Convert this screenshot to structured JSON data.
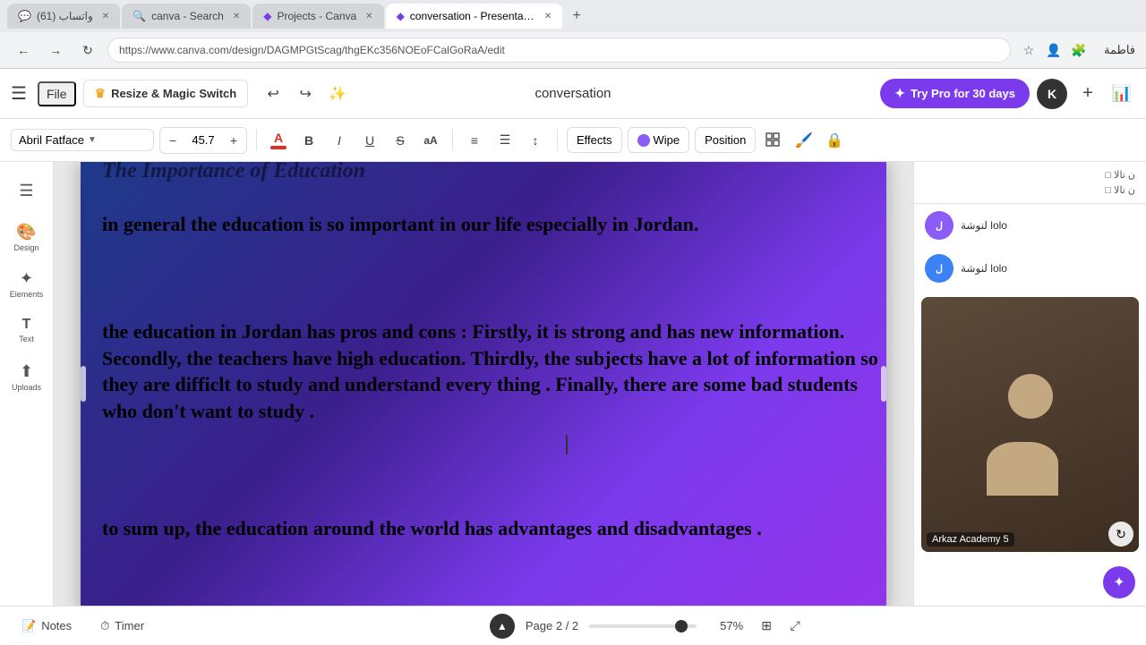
{
  "browser": {
    "tabs": [
      {
        "id": "tab1",
        "label": "واتساب (61)",
        "favicon": "💬",
        "active": false,
        "color": "#25d366"
      },
      {
        "id": "tab2",
        "label": "canva - Search",
        "favicon": "🔍",
        "active": false,
        "color": "#aaa"
      },
      {
        "id": "tab3",
        "label": "Projects - Canva",
        "favicon": "◆",
        "active": false,
        "color": "#7c3aed"
      },
      {
        "id": "tab4",
        "label": "conversation - Presentation",
        "favicon": "◆",
        "active": true,
        "color": "#7c3aed"
      }
    ],
    "url": "https://www.canva.com/design/DAGMPGtScag/thgEKc356NOEoFCalGoRaA/edit",
    "arabic_name": "فاطمة"
  },
  "toolbar": {
    "file_label": "File",
    "resize_label": "Resize & Magic Switch",
    "title": "conversation",
    "pro_label": "Try Pro for 30 days",
    "avatar_letter": "K"
  },
  "format_bar": {
    "font_name": "Abril Fatface",
    "font_size": "45.7",
    "effects_label": "Effects",
    "wipe_label": "Wipe",
    "position_label": "Position"
  },
  "slide": {
    "text1": "in general the education is so important in our life especially in Jordan.",
    "text2": "the education in Jordan has pros and cons : Firstly, it is strong and has new information.  Secondly, the teachers have high education. Thirdly, the subjects have a lot of information so they are  difficlt to study and understand every thing . Finally, there are some bad students who don't want to study .",
    "text3": "to sum up, the education around the world has advantages and disadvantages ."
  },
  "participants": [
    {
      "name": "لنوشة lolo",
      "avatar_color": "#8b5cf6",
      "initials": "ل"
    },
    {
      "name": "لنوشة lolo",
      "avatar_color": "#3b82f6",
      "initials": "ل"
    }
  ],
  "video": {
    "label": "Arkaz Academy 5"
  },
  "bottom_bar": {
    "notes_label": "Notes",
    "timer_label": "Timer",
    "page_info": "Page 2 / 2",
    "zoom": "57%"
  },
  "sidebar_items": [
    {
      "icon": "☰",
      "label": ""
    },
    {
      "icon": "✏️",
      "label": "Design"
    },
    {
      "icon": "🎨",
      "label": "Elements"
    },
    {
      "icon": "T",
      "label": "Text"
    },
    {
      "icon": "🎬",
      "label": "Uploads"
    }
  ]
}
